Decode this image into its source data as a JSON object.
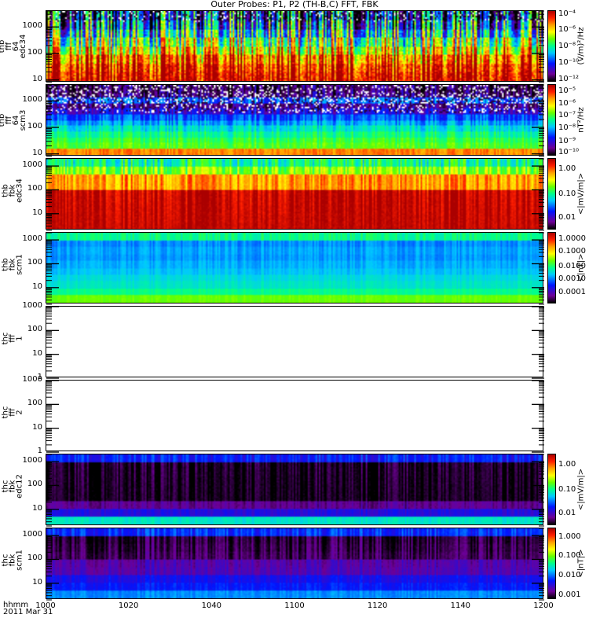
{
  "title": "Outer Probes: P1, P2 (TH-B,C) FFT, FBK",
  "xaxis": {
    "unit_label": "hhmm",
    "date_label": "2011 Mar 31",
    "ticks": [
      "1000",
      "1020",
      "1040",
      "1100",
      "1120",
      "1140",
      "1200"
    ]
  },
  "colors": {
    "frame": "#000000",
    "background": "#ffffff"
  },
  "chart_data": [
    {
      "type": "heatmap",
      "ylabel": [
        "thb",
        "fff",
        "64",
        "edc34"
      ],
      "ylim": [
        8,
        4000
      ],
      "yticks": [
        "10",
        "100",
        "1000"
      ],
      "ytick_values": [
        10,
        100,
        1000
      ],
      "cbar_ticks": [
        "10⁻⁴",
        "10⁻⁶",
        "10⁻⁸",
        "10⁻¹⁰",
        "10⁻¹²"
      ],
      "cbar_tick_fracs": [
        0.95,
        0.72,
        0.49,
        0.26,
        0.03
      ],
      "cbar_unit": "(V/m)²/Hz",
      "approx_level_profile": [
        0.95,
        0.92,
        0.85,
        0.72,
        0.6,
        0.45,
        0.33,
        0.22
      ],
      "variability": 0.3,
      "gaps_top": 0.12,
      "seed": 3
    },
    {
      "type": "heatmap",
      "ylabel": [
        "thb",
        "fff",
        "64",
        "scm3"
      ],
      "ylim": [
        8,
        4000
      ],
      "yticks": [
        "10",
        "100",
        "1000"
      ],
      "ytick_values": [
        10,
        100,
        1000
      ],
      "cbar_ticks": [
        "10⁻⁵",
        "10⁻⁶",
        "10⁻⁷",
        "10⁻⁸",
        "10⁻⁹",
        "10⁻¹⁰"
      ],
      "cbar_tick_fracs": [
        0.9,
        0.73,
        0.56,
        0.39,
        0.2,
        0.04
      ],
      "cbar_unit": "nT²/Hz",
      "approx_level_profile": [
        0.82,
        0.58,
        0.55,
        0.5,
        0.44,
        0.37,
        0.3,
        0.2,
        0.12,
        0.3,
        0.1,
        0.08
      ],
      "variability": 0.08,
      "gaps_top": 0.3,
      "seed": 7
    },
    {
      "type": "heatmap",
      "ylabel": [
        "thb",
        "fbk",
        "edc34"
      ],
      "ylim": [
        2,
        2000
      ],
      "yticks": [
        "10",
        "100",
        "1000"
      ],
      "ytick_values": [
        10,
        100,
        1000
      ],
      "cbar_ticks": [
        "1.00",
        "0.10",
        "0.01"
      ],
      "cbar_tick_fracs": [
        0.85,
        0.5,
        0.16
      ],
      "cbar_unit": "<|mV/m|>",
      "approx_level_profile": [
        0.97,
        0.97,
        0.97,
        0.97,
        0.97,
        0.8,
        0.8,
        0.62,
        0.5
      ],
      "variability": 0.08,
      "gaps_top": 0,
      "seed": 11
    },
    {
      "type": "heatmap",
      "ylabel": [
        "thb",
        "fbk",
        "scm1"
      ],
      "ylim": [
        2,
        2000
      ],
      "yticks": [
        "10",
        "100",
        "1000"
      ],
      "ytick_values": [
        10,
        100,
        1000
      ],
      "cbar_ticks": [
        "1.0000",
        "0.1000",
        "0.0100",
        "0.0010",
        "0.0001"
      ],
      "cbar_tick_fracs": [
        0.9,
        0.72,
        0.52,
        0.34,
        0.15
      ],
      "cbar_unit": "<|nT|>",
      "approx_level_profile": [
        0.6,
        0.5,
        0.45,
        0.43,
        0.4,
        0.38,
        0.36,
        0.37,
        0.35,
        0.5
      ],
      "variability": 0.03,
      "gaps_top": 0,
      "seed": 13
    },
    {
      "type": "heatmap",
      "ylabel": [
        "thc",
        "fff",
        "1"
      ],
      "ylim": [
        1,
        1000
      ],
      "yticks": [
        "1",
        "10",
        "100",
        "1000"
      ],
      "ytick_values": [
        1,
        10,
        100,
        1000
      ],
      "cbar_ticks": [],
      "cbar_unit": "",
      "empty": true
    },
    {
      "type": "heatmap",
      "ylabel": [
        "thc",
        "fff",
        "2"
      ],
      "ylim": [
        1,
        1000
      ],
      "yticks": [
        "1",
        "10",
        "100",
        "1000"
      ],
      "ytick_values": [
        1,
        10,
        100,
        1000
      ],
      "cbar_ticks": [],
      "cbar_unit": "",
      "empty": true
    },
    {
      "type": "heatmap",
      "ylabel": [
        "thc",
        "fbk",
        "edc12"
      ],
      "ylim": [
        2,
        2000
      ],
      "yticks": [
        "10",
        "100",
        "1000"
      ],
      "ytick_values": [
        10,
        100,
        1000
      ],
      "cbar_ticks": [
        "1.00",
        "0.10",
        "0.01"
      ],
      "cbar_tick_fracs": [
        0.85,
        0.5,
        0.16
      ],
      "cbar_unit": "<|mV/m|>",
      "approx_level_profile": [
        0.45,
        0.2,
        0.1,
        0.02,
        0.02,
        0.02,
        0.02,
        0.02,
        0.25
      ],
      "variability": 0.05,
      "gaps_top": 0,
      "seed": 17
    },
    {
      "type": "heatmap",
      "ylabel": [
        "thc",
        "fbk",
        "scm1"
      ],
      "ylim": [
        2,
        2000
      ],
      "yticks": [
        "10",
        "100",
        "1000"
      ],
      "ytick_values": [
        10,
        100,
        1000
      ],
      "cbar_ticks": [
        "1.000",
        "0.100",
        "0.010",
        "0.001"
      ],
      "cbar_tick_fracs": [
        0.87,
        0.6,
        0.33,
        0.06
      ],
      "cbar_unit": "<|nT|>",
      "approx_level_profile": [
        0.35,
        0.25,
        0.22,
        0.14,
        0.13,
        0.06,
        0.05,
        0.04,
        0.27
      ],
      "variability": 0.05,
      "gaps_top": 0,
      "seed": 19
    }
  ]
}
